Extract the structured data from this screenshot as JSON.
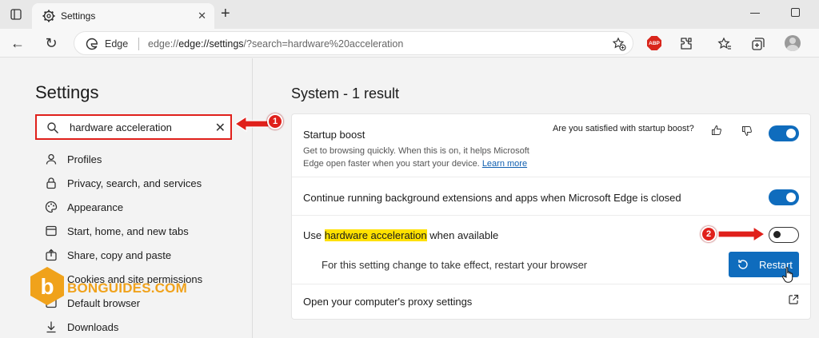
{
  "browser": {
    "tab_title": "Settings",
    "address_label": "Edge",
    "url_host": "edge://settings",
    "url_path": "/?search=hardware%20acceleration",
    "abp_label": "ABP"
  },
  "sidebar": {
    "title": "Settings",
    "search_value": "hardware acceleration",
    "items": [
      {
        "label": "Profiles",
        "icon": "profile-icon"
      },
      {
        "label": "Privacy, search, and services",
        "icon": "lock-icon"
      },
      {
        "label": "Appearance",
        "icon": "palette-icon"
      },
      {
        "label": "Start, home, and new tabs",
        "icon": "power-icon"
      },
      {
        "label": "Share, copy and paste",
        "icon": "share-icon"
      },
      {
        "label": "Cookies and site permissions",
        "icon": "cookie-icon"
      },
      {
        "label": "Default browser",
        "icon": "browser-icon"
      },
      {
        "label": "Downloads",
        "icon": "download-icon"
      }
    ]
  },
  "main": {
    "title": "System - 1 result",
    "startup_boost": {
      "label": "Startup boost",
      "feedback": "Are you satisfied with startup boost?",
      "desc_line1": "Get to browsing quickly. When this is on, it helps Microsoft",
      "desc_line2": "Edge open faster when you start your device.",
      "learn_more": "Learn more",
      "enabled": true
    },
    "background": {
      "label": "Continue running background extensions and apps when Microsoft Edge is closed",
      "enabled": true
    },
    "hw_accel": {
      "prefix": "Use ",
      "highlight": "hardware acceleration",
      "suffix": " when available",
      "enabled": false,
      "restart_note": "For this setting change to take effect, restart your browser",
      "restart_label": "Restart"
    },
    "proxy": {
      "label": "Open your computer's proxy settings"
    }
  },
  "annotations": {
    "badge1": "1",
    "badge2": "2"
  },
  "watermark": "BONGUIDES.COM",
  "colors": {
    "accent": "#0f6cbd",
    "annotation": "#e0201b",
    "highlight": "#ffe100",
    "watermark": "#f0a21b"
  }
}
